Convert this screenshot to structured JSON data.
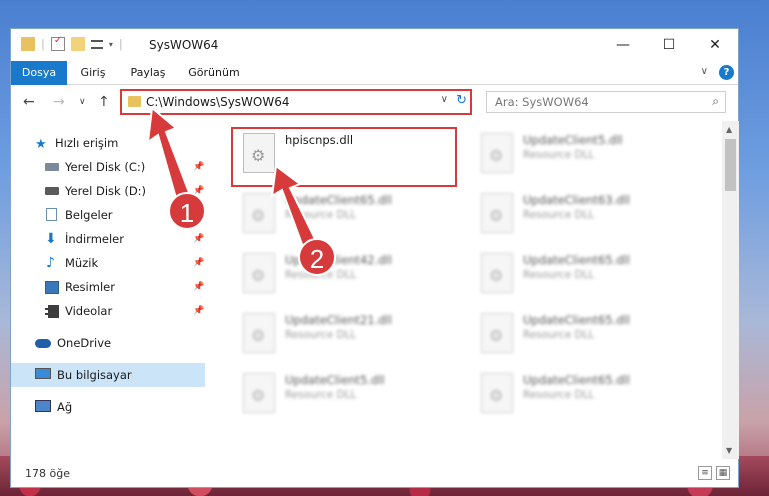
{
  "window": {
    "title": "SysWOW64",
    "controls": {
      "minimize": "—",
      "maximize": "☐",
      "close": "✕"
    }
  },
  "ribbon": {
    "tabs": [
      {
        "label": "Dosya",
        "active": true
      },
      {
        "label": "Giriş"
      },
      {
        "label": "Paylaş"
      },
      {
        "label": "Görünüm"
      }
    ],
    "help": "?",
    "expand": "∨"
  },
  "nav": {
    "back": "←",
    "forward": "→",
    "recent": "∨",
    "up": "↑"
  },
  "address": {
    "path": "C:\\Windows\\SysWOW64",
    "dropdown": "∨",
    "refresh": "↻"
  },
  "search": {
    "placeholder": "Ara: SysWOW64",
    "icon": "⌕"
  },
  "sidebar": {
    "items": [
      {
        "label": "Hızlı erişim",
        "icon": "star-icon",
        "color": "#1979ca"
      },
      {
        "label": "Yerel Disk (C:)",
        "icon": "drive-icon",
        "pinned": true
      },
      {
        "label": "Yerel Disk (D:)",
        "icon": "drive-icon",
        "pinned": true
      },
      {
        "label": "Belgeler",
        "icon": "document-icon",
        "pinned": true
      },
      {
        "label": "İndirmeler",
        "icon": "download-icon",
        "pinned": true
      },
      {
        "label": "Müzik",
        "icon": "music-icon",
        "pinned": true
      },
      {
        "label": "Resimler",
        "icon": "pictures-icon",
        "pinned": true
      },
      {
        "label": "Videolar",
        "icon": "video-icon",
        "pinned": true
      },
      {
        "label": "OneDrive",
        "icon": "cloud-icon"
      },
      {
        "label": "Bu bilgisayar",
        "icon": "computer-icon",
        "selected": true
      },
      {
        "label": "Ağ",
        "icon": "network-icon"
      }
    ],
    "pin_glyph": "📌"
  },
  "files": [
    {
      "name": "hpiscnps.dll",
      "type": ""
    },
    {
      "name": "UpdateClient5.dll",
      "type": "Resource DLL"
    },
    {
      "name": "UpdateClient65.dll",
      "type": "Resource DLL"
    },
    {
      "name": "UpdateClient63.dll",
      "type": "Resource DLL"
    },
    {
      "name": "UpdateClient42.dll",
      "type": "Resource DLL"
    },
    {
      "name": "UpdateClient65.dll",
      "type": "Resource DLL"
    },
    {
      "name": "UpdateClient21.dll",
      "type": "Resource DLL"
    },
    {
      "name": "UpdateClient65.dll",
      "type": "Resource DLL"
    },
    {
      "name": "UpdateClient5.dll",
      "type": "Resource DLL"
    },
    {
      "name": "UpdateClient65.dll",
      "type": "Resource DLL"
    }
  ],
  "status": {
    "item_count": "178 öğe"
  },
  "annotations": {
    "step1": "1",
    "step2": "2",
    "color": "#d63a3a"
  },
  "scroll": {
    "up": "▲",
    "down": "▼"
  }
}
